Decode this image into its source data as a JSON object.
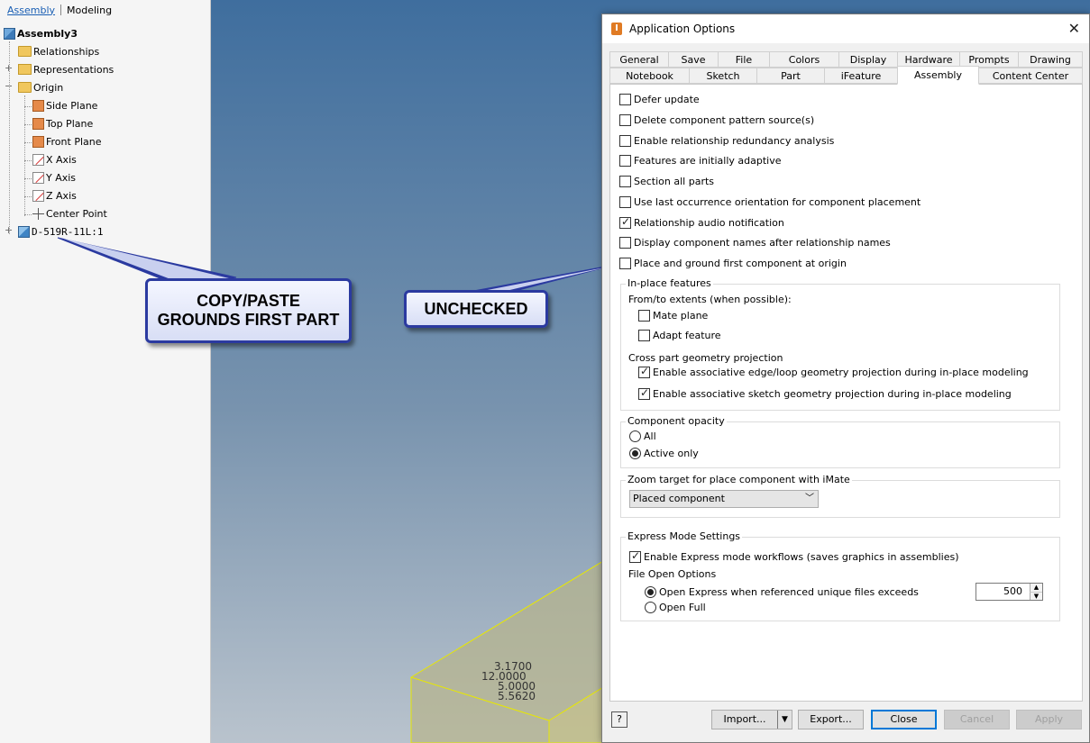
{
  "browser": {
    "tabs": [
      "Assembly",
      "Modeling"
    ],
    "tree": {
      "root": "Assembly3",
      "relationships": "Relationships",
      "representations": "Representations",
      "origin": "Origin",
      "side_plane": "Side Plane",
      "top_plane": "Top Plane",
      "front_plane": "Front Plane",
      "x_axis": "X Axis",
      "y_axis": "Y Axis",
      "z_axis": "Z Axis",
      "center_point": "Center Point",
      "part": "D-519R-11L:1"
    }
  },
  "callouts": {
    "left_line1": "COPY/PASTE",
    "left_line2": "GROUNDS FIRST PART",
    "right": "UNCHECKED"
  },
  "viewport": {
    "dimension_labels": [
      "3.1700",
      "12.0000",
      "5.0000",
      "5.5620"
    ]
  },
  "dialog": {
    "title": "Application Options",
    "tabs_row1": [
      "General",
      "Save",
      "File",
      "Colors",
      "Display",
      "Hardware",
      "Prompts",
      "Drawing"
    ],
    "tabs_row2": [
      "Notebook",
      "Sketch",
      "Part",
      "iFeature",
      "Assembly",
      "Content Center"
    ],
    "active_tab": "Assembly",
    "options": [
      {
        "label": "Defer update",
        "checked": false
      },
      {
        "label": "Delete component pattern source(s)",
        "checked": false
      },
      {
        "label": "Enable relationship redundancy analysis",
        "checked": false
      },
      {
        "label": "Features are initially adaptive",
        "checked": false
      },
      {
        "label": "Section all parts",
        "checked": false
      },
      {
        "label": "Use last occurrence orientation for component placement",
        "checked": false
      },
      {
        "label": "Relationship audio notification",
        "checked": true
      },
      {
        "label": "Display component names after relationship names",
        "checked": false
      },
      {
        "label": "Place and ground first component at origin",
        "checked": false
      }
    ],
    "inplace": {
      "legend": "In-place features",
      "extents_label": "From/to extents (when possible):",
      "mate_plane": "Mate plane",
      "adapt_feature": "Adapt feature",
      "cross_part_label": "Cross part geometry projection",
      "edge_loop": "Enable associative edge/loop geometry projection during in-place modeling",
      "sketch_geom": "Enable associative sketch geometry projection during in-place modeling"
    },
    "opacity": {
      "legend": "Component opacity",
      "all": "All",
      "active_only": "Active only"
    },
    "zoom": {
      "legend": "Zoom target for place component with iMate",
      "selected": "Placed component"
    },
    "express": {
      "legend": "Express Mode Settings",
      "enable": "Enable Express mode workflows (saves graphics in assemblies)",
      "file_open_label": "File Open Options",
      "open_express": "Open Express when referenced unique files exceeds",
      "threshold": "500",
      "open_full": "Open Full"
    },
    "buttons": {
      "help": "?",
      "import": "Import...",
      "export": "Export...",
      "close": "Close",
      "cancel": "Cancel",
      "apply": "Apply"
    }
  }
}
